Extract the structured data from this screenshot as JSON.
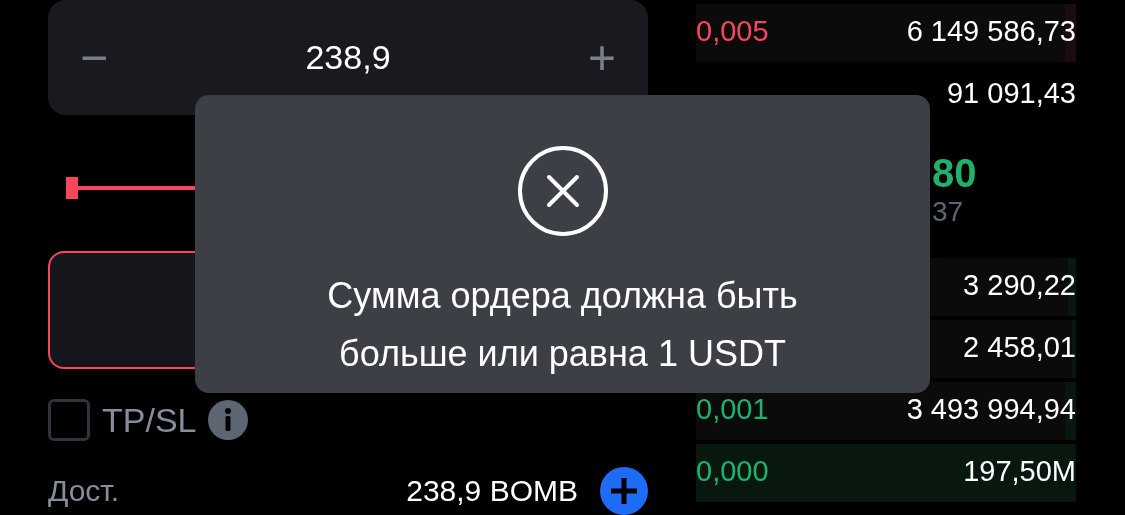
{
  "amount_stepper": {
    "value": "238,9",
    "minus": "−",
    "plus": "+"
  },
  "slider": {
    "level": 0
  },
  "total_field": {
    "error": true
  },
  "tp_sl": {
    "label": "TP/SL",
    "checked": false
  },
  "available": {
    "label": "Дост.",
    "value": "238,9 BOMB"
  },
  "order_book": {
    "asks": [
      {
        "price": "0,005",
        "amount": "6 149 586,73",
        "level": 0.03
      },
      {
        "amount": "91 091,43"
      }
    ],
    "last_price": "80",
    "mark_price": "37",
    "bids": [
      {
        "amount": "3 290,22",
        "level": 0.02
      },
      {
        "amount": "2 458,01",
        "level": 0.01
      },
      {
        "price": "0,001",
        "amount": "3 493 994,94",
        "level": 0.03
      },
      {
        "price": "0,000",
        "amount": "197,50M",
        "level": 1
      }
    ]
  },
  "toast": {
    "kind": "error",
    "message": "Сумма ордера должна быть больше или равна 1 USDT"
  }
}
